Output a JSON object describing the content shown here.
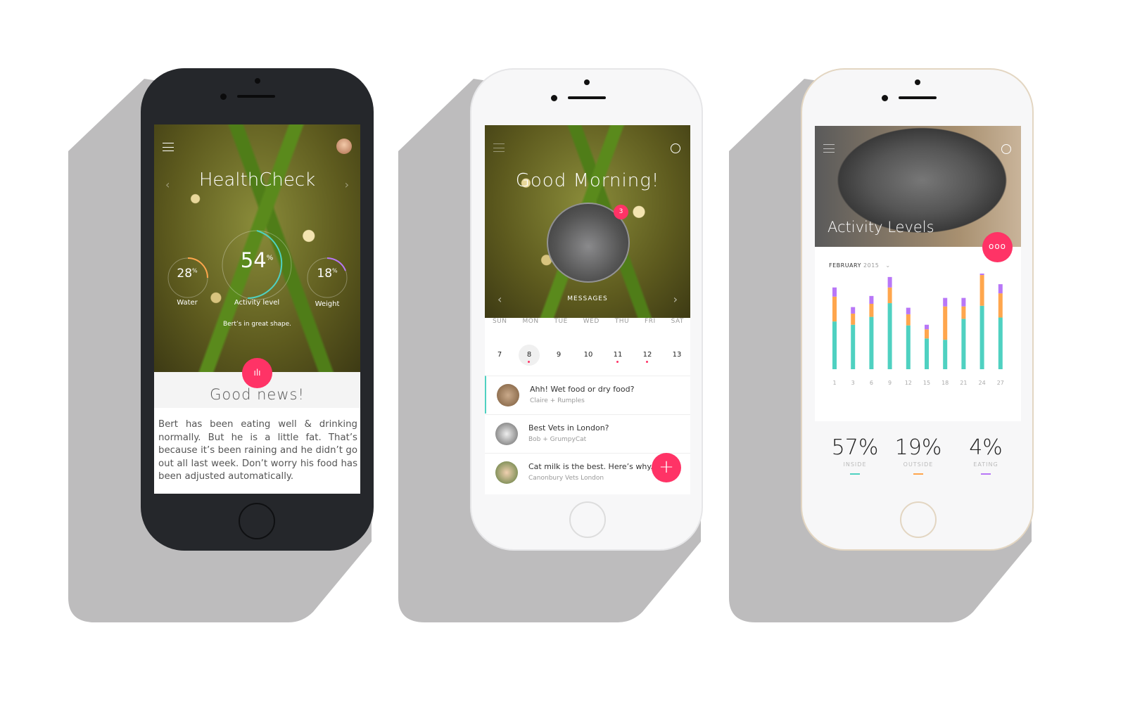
{
  "phone1": {
    "title": "HealthCheck",
    "water": {
      "value": "28",
      "unit": "%",
      "label": "Water",
      "fraction": 0.28
    },
    "activity": {
      "value": "54",
      "unit": "%",
      "label": "Activity level",
      "fraction": 0.54
    },
    "weight": {
      "value": "18",
      "unit": "%",
      "label": "Weight",
      "fraction": 0.18
    },
    "status": "Bert’s in great shape.",
    "heading": "Good news!",
    "body": "Bert has been eating well & drinking normally. But he is a little fat. That’s because it’s been raining and he didn’t go out all last week. Don’t worry his food has been adjusted automatically."
  },
  "phone2": {
    "greeting": "Good Morning!",
    "badge": "3",
    "messages_label": "MESSAGES",
    "days": [
      "SUN",
      "MON",
      "TUE",
      "WED",
      "THU",
      "FRI",
      "SAT"
    ],
    "dates": [
      "7",
      "8",
      "9",
      "10",
      "11",
      "12",
      "13"
    ],
    "messages": [
      {
        "title": "Ahh! Wet food or dry food?",
        "sub": "Claire + Rumples"
      },
      {
        "title": "Best Vets in London?",
        "sub": "Bob + GrumpyCat"
      },
      {
        "title": "Cat milk is the best. Here’s why.",
        "sub": "Canonbury Vets London"
      }
    ],
    "fab": "+"
  },
  "phone3": {
    "title": "Activity Levels",
    "month": "FEBRUARY",
    "year": "2015",
    "stats": [
      {
        "value": "57%",
        "label": "INSIDE"
      },
      {
        "value": "19%",
        "label": "OUTSIDE"
      },
      {
        "value": "4%",
        "label": "EATING"
      }
    ]
  },
  "colors": {
    "accent": "#ff3366",
    "inside": "#4fd1c1",
    "outside": "#ffa64d",
    "eating": "#b877f7"
  },
  "chart_data": {
    "type": "bar",
    "stacked": true,
    "categories": [
      "1",
      "3",
      "6",
      "9",
      "12",
      "15",
      "18",
      "21",
      "24",
      "27"
    ],
    "series": [
      {
        "name": "INSIDE",
        "values": [
          73,
          68,
          80,
          101,
          67,
          47,
          45,
          77,
          97,
          79
        ]
      },
      {
        "name": "OUTSIDE",
        "values": [
          38,
          17,
          20,
          24,
          17,
          14,
          51,
          19,
          47,
          37
        ]
      },
      {
        "name": "EATING",
        "values": [
          14,
          10,
          12,
          16,
          10,
          7,
          13,
          13,
          18,
          14
        ]
      }
    ]
  }
}
